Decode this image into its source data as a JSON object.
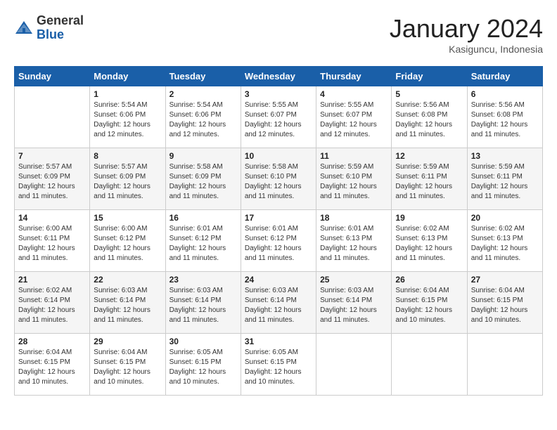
{
  "logo": {
    "general": "General",
    "blue": "Blue"
  },
  "header": {
    "month": "January 2024",
    "location": "Kasiguncu, Indonesia"
  },
  "weekdays": [
    "Sunday",
    "Monday",
    "Tuesday",
    "Wednesday",
    "Thursday",
    "Friday",
    "Saturday"
  ],
  "weeks": [
    [
      {
        "day": "",
        "sunrise": "",
        "sunset": "",
        "daylight": ""
      },
      {
        "day": "1",
        "sunrise": "Sunrise: 5:54 AM",
        "sunset": "Sunset: 6:06 PM",
        "daylight": "Daylight: 12 hours and 12 minutes."
      },
      {
        "day": "2",
        "sunrise": "Sunrise: 5:54 AM",
        "sunset": "Sunset: 6:06 PM",
        "daylight": "Daylight: 12 hours and 12 minutes."
      },
      {
        "day": "3",
        "sunrise": "Sunrise: 5:55 AM",
        "sunset": "Sunset: 6:07 PM",
        "daylight": "Daylight: 12 hours and 12 minutes."
      },
      {
        "day": "4",
        "sunrise": "Sunrise: 5:55 AM",
        "sunset": "Sunset: 6:07 PM",
        "daylight": "Daylight: 12 hours and 12 minutes."
      },
      {
        "day": "5",
        "sunrise": "Sunrise: 5:56 AM",
        "sunset": "Sunset: 6:08 PM",
        "daylight": "Daylight: 12 hours and 11 minutes."
      },
      {
        "day": "6",
        "sunrise": "Sunrise: 5:56 AM",
        "sunset": "Sunset: 6:08 PM",
        "daylight": "Daylight: 12 hours and 11 minutes."
      }
    ],
    [
      {
        "day": "7",
        "sunrise": "Sunrise: 5:57 AM",
        "sunset": "Sunset: 6:09 PM",
        "daylight": "Daylight: 12 hours and 11 minutes."
      },
      {
        "day": "8",
        "sunrise": "Sunrise: 5:57 AM",
        "sunset": "Sunset: 6:09 PM",
        "daylight": "Daylight: 12 hours and 11 minutes."
      },
      {
        "day": "9",
        "sunrise": "Sunrise: 5:58 AM",
        "sunset": "Sunset: 6:09 PM",
        "daylight": "Daylight: 12 hours and 11 minutes."
      },
      {
        "day": "10",
        "sunrise": "Sunrise: 5:58 AM",
        "sunset": "Sunset: 6:10 PM",
        "daylight": "Daylight: 12 hours and 11 minutes."
      },
      {
        "day": "11",
        "sunrise": "Sunrise: 5:59 AM",
        "sunset": "Sunset: 6:10 PM",
        "daylight": "Daylight: 12 hours and 11 minutes."
      },
      {
        "day": "12",
        "sunrise": "Sunrise: 5:59 AM",
        "sunset": "Sunset: 6:11 PM",
        "daylight": "Daylight: 12 hours and 11 minutes."
      },
      {
        "day": "13",
        "sunrise": "Sunrise: 5:59 AM",
        "sunset": "Sunset: 6:11 PM",
        "daylight": "Daylight: 12 hours and 11 minutes."
      }
    ],
    [
      {
        "day": "14",
        "sunrise": "Sunrise: 6:00 AM",
        "sunset": "Sunset: 6:11 PM",
        "daylight": "Daylight: 12 hours and 11 minutes."
      },
      {
        "day": "15",
        "sunrise": "Sunrise: 6:00 AM",
        "sunset": "Sunset: 6:12 PM",
        "daylight": "Daylight: 12 hours and 11 minutes."
      },
      {
        "day": "16",
        "sunrise": "Sunrise: 6:01 AM",
        "sunset": "Sunset: 6:12 PM",
        "daylight": "Daylight: 12 hours and 11 minutes."
      },
      {
        "day": "17",
        "sunrise": "Sunrise: 6:01 AM",
        "sunset": "Sunset: 6:12 PM",
        "daylight": "Daylight: 12 hours and 11 minutes."
      },
      {
        "day": "18",
        "sunrise": "Sunrise: 6:01 AM",
        "sunset": "Sunset: 6:13 PM",
        "daylight": "Daylight: 12 hours and 11 minutes."
      },
      {
        "day": "19",
        "sunrise": "Sunrise: 6:02 AM",
        "sunset": "Sunset: 6:13 PM",
        "daylight": "Daylight: 12 hours and 11 minutes."
      },
      {
        "day": "20",
        "sunrise": "Sunrise: 6:02 AM",
        "sunset": "Sunset: 6:13 PM",
        "daylight": "Daylight: 12 hours and 11 minutes."
      }
    ],
    [
      {
        "day": "21",
        "sunrise": "Sunrise: 6:02 AM",
        "sunset": "Sunset: 6:14 PM",
        "daylight": "Daylight: 12 hours and 11 minutes."
      },
      {
        "day": "22",
        "sunrise": "Sunrise: 6:03 AM",
        "sunset": "Sunset: 6:14 PM",
        "daylight": "Daylight: 12 hours and 11 minutes."
      },
      {
        "day": "23",
        "sunrise": "Sunrise: 6:03 AM",
        "sunset": "Sunset: 6:14 PM",
        "daylight": "Daylight: 12 hours and 11 minutes."
      },
      {
        "day": "24",
        "sunrise": "Sunrise: 6:03 AM",
        "sunset": "Sunset: 6:14 PM",
        "daylight": "Daylight: 12 hours and 11 minutes."
      },
      {
        "day": "25",
        "sunrise": "Sunrise: 6:03 AM",
        "sunset": "Sunset: 6:14 PM",
        "daylight": "Daylight: 12 hours and 11 minutes."
      },
      {
        "day": "26",
        "sunrise": "Sunrise: 6:04 AM",
        "sunset": "Sunset: 6:15 PM",
        "daylight": "Daylight: 12 hours and 10 minutes."
      },
      {
        "day": "27",
        "sunrise": "Sunrise: 6:04 AM",
        "sunset": "Sunset: 6:15 PM",
        "daylight": "Daylight: 12 hours and 10 minutes."
      }
    ],
    [
      {
        "day": "28",
        "sunrise": "Sunrise: 6:04 AM",
        "sunset": "Sunset: 6:15 PM",
        "daylight": "Daylight: 12 hours and 10 minutes."
      },
      {
        "day": "29",
        "sunrise": "Sunrise: 6:04 AM",
        "sunset": "Sunset: 6:15 PM",
        "daylight": "Daylight: 12 hours and 10 minutes."
      },
      {
        "day": "30",
        "sunrise": "Sunrise: 6:05 AM",
        "sunset": "Sunset: 6:15 PM",
        "daylight": "Daylight: 12 hours and 10 minutes."
      },
      {
        "day": "31",
        "sunrise": "Sunrise: 6:05 AM",
        "sunset": "Sunset: 6:15 PM",
        "daylight": "Daylight: 12 hours and 10 minutes."
      },
      {
        "day": "",
        "sunrise": "",
        "sunset": "",
        "daylight": ""
      },
      {
        "day": "",
        "sunrise": "",
        "sunset": "",
        "daylight": ""
      },
      {
        "day": "",
        "sunrise": "",
        "sunset": "",
        "daylight": ""
      }
    ]
  ]
}
